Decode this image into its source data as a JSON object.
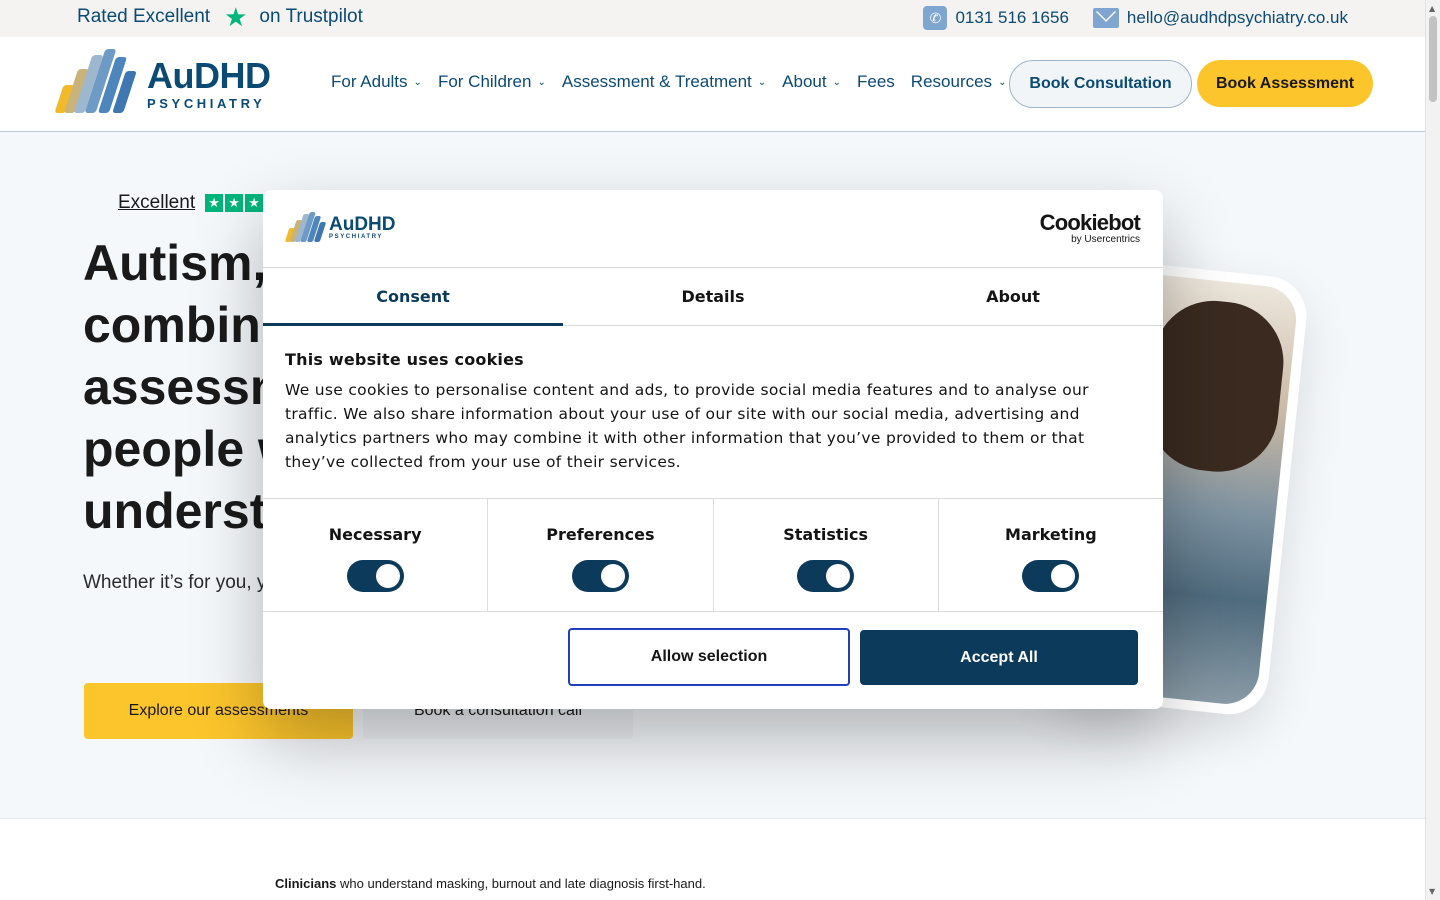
{
  "topbar": {
    "rated": "Rated Excellent",
    "on": "on Trustpilot",
    "phone": "0131 516 1656",
    "email": "hello@audhdpsychiatry.co.uk"
  },
  "logo": {
    "big": "AuDHD",
    "small": "PSYCHIATRY"
  },
  "nav": {
    "items": [
      {
        "label": "For Adults",
        "dropdown": true
      },
      {
        "label": "For Children",
        "dropdown": true
      },
      {
        "label": "Assessment & Treatment",
        "dropdown": true
      },
      {
        "label": "About",
        "dropdown": true
      },
      {
        "label": "Fees",
        "dropdown": false
      },
      {
        "label": "Resources",
        "dropdown": true
      }
    ],
    "chevron": "⌄",
    "book_consultation": "Book Consultation",
    "book_assessment": "Book Assessment"
  },
  "hero": {
    "tp_label": "Excellent",
    "title_lines": [
      "Autism,",
      "combin",
      "assessn",
      "people w",
      "underst"
    ],
    "text": "Whether it’s for you, y we assess and suppo online, privately or thr",
    "explore": "Explore our assessments",
    "call": "Book a consultation call"
  },
  "below": {
    "bold": "Clinicians",
    "rest": " who understand masking, burnout and late diagnosis first-hand."
  },
  "cookie": {
    "logo_big": "AuDHD",
    "logo_small": "PSYCHIATRY",
    "brand": "Cookiebot",
    "brand_by": "by Usercentrics",
    "tabs": [
      "Consent",
      "Details",
      "About"
    ],
    "active_tab": "Consent",
    "heading": "This website uses cookies",
    "body": "We use cookies to personalise content and ads, to provide social media features and to analyse our traffic. We also share information about your use of our site with our social media, advertising and analytics partners who may combine it with other information that you’ve provided to them or that they’ve collected from your use of their services.",
    "categories": [
      {
        "label": "Necessary",
        "on": true
      },
      {
        "label": "Preferences",
        "on": true
      },
      {
        "label": "Statistics",
        "on": true
      },
      {
        "label": "Marketing",
        "on": true
      }
    ],
    "allow_selection": "Allow selection",
    "accept_all": "Accept All"
  },
  "colors": {
    "navy": "#0b3a5b",
    "brand_blue": "#0b4a73",
    "yellow": "#fcc52c",
    "trustpilot_green": "#00b67a",
    "focus_blue": "#1f3fbf"
  },
  "icons": {
    "trustpilot": "star-icon",
    "phone": "phone-icon",
    "email": "mail-icon"
  }
}
